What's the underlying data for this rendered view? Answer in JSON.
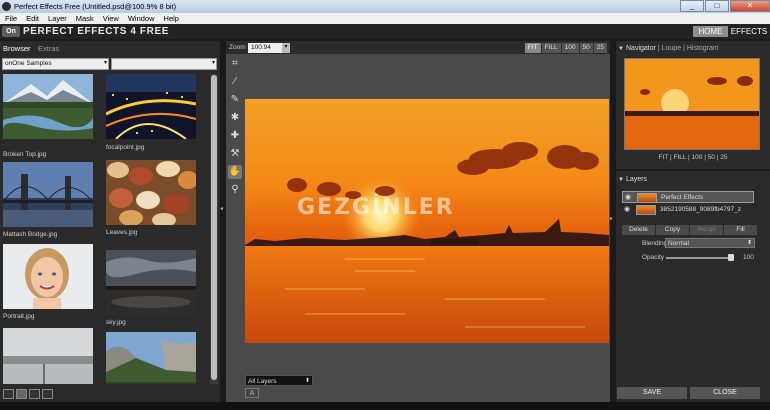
{
  "window": {
    "title": "Perfect Effects Free (Untitled.psd@100.9% 8 bit)",
    "controls": [
      "_",
      "□",
      "✕"
    ]
  },
  "menu": [
    "File",
    "Edit",
    "Layer",
    "Mask",
    "View",
    "Window",
    "Help"
  ],
  "header": {
    "logo": "On",
    "app_name": "PERFECT EFFECTS 4 FREE",
    "home_label": "HOME",
    "effects_label": "EFFECTS"
  },
  "browser": {
    "tabs": [
      "Browser",
      "Extras"
    ],
    "folder_select": "onOne Samples",
    "second_select": "",
    "thumbnails": [
      {
        "label": "Broken Top.jpg",
        "icon": "mountain-lake-thumb"
      },
      {
        "label": "focalpoint.jpg",
        "icon": "city-night-thumb"
      },
      {
        "label": "Mattash Bridge.jpg",
        "icon": "bridge-thumb"
      },
      {
        "label": "Leaves.jpg",
        "icon": "leaves-thumb"
      },
      {
        "label": "Portrait.jpg",
        "icon": "portrait-thumb"
      },
      {
        "label": "sky.jpg",
        "icon": "sky-thumb"
      },
      {
        "label": "",
        "icon": "misty-lake-thumb"
      },
      {
        "label": "",
        "icon": "yosemite-thumb"
      }
    ]
  },
  "canvas": {
    "zoom_label": "Zoom",
    "zoom_value": "100.94",
    "fit_buttons": [
      "FIT",
      "FILL",
      "100",
      "50",
      "25"
    ],
    "watermark": "GEZGİNLER",
    "layers_filter": "All Layers",
    "bottom_button": "A"
  },
  "navigator": {
    "tabs": "Navigator | Loupe | Histogram",
    "tab_active": "Navigator",
    "tab_rest": " | Loupe | Histogram",
    "zoom_options": "FIT | FILL | 100 | 50 | 25"
  },
  "layers": {
    "title": "Layers",
    "items": [
      "Perfect Effects",
      "3852190588_9089fb4797_z"
    ],
    "buttons": [
      "Delete",
      "Copy",
      "Merge",
      "Fill"
    ],
    "blending_label": "Blending",
    "blending_value": "Normal",
    "opacity_label": "Opacity",
    "opacity_value": "100",
    "opacity_fraction": 1.0
  },
  "footer": {
    "save_label": "SAVE",
    "close_label": "CLOSE"
  },
  "colors": {
    "sunset_orange": "#f07a12",
    "panel_bg": "#2a2a2a",
    "center_bg": "#4a4a4a"
  }
}
